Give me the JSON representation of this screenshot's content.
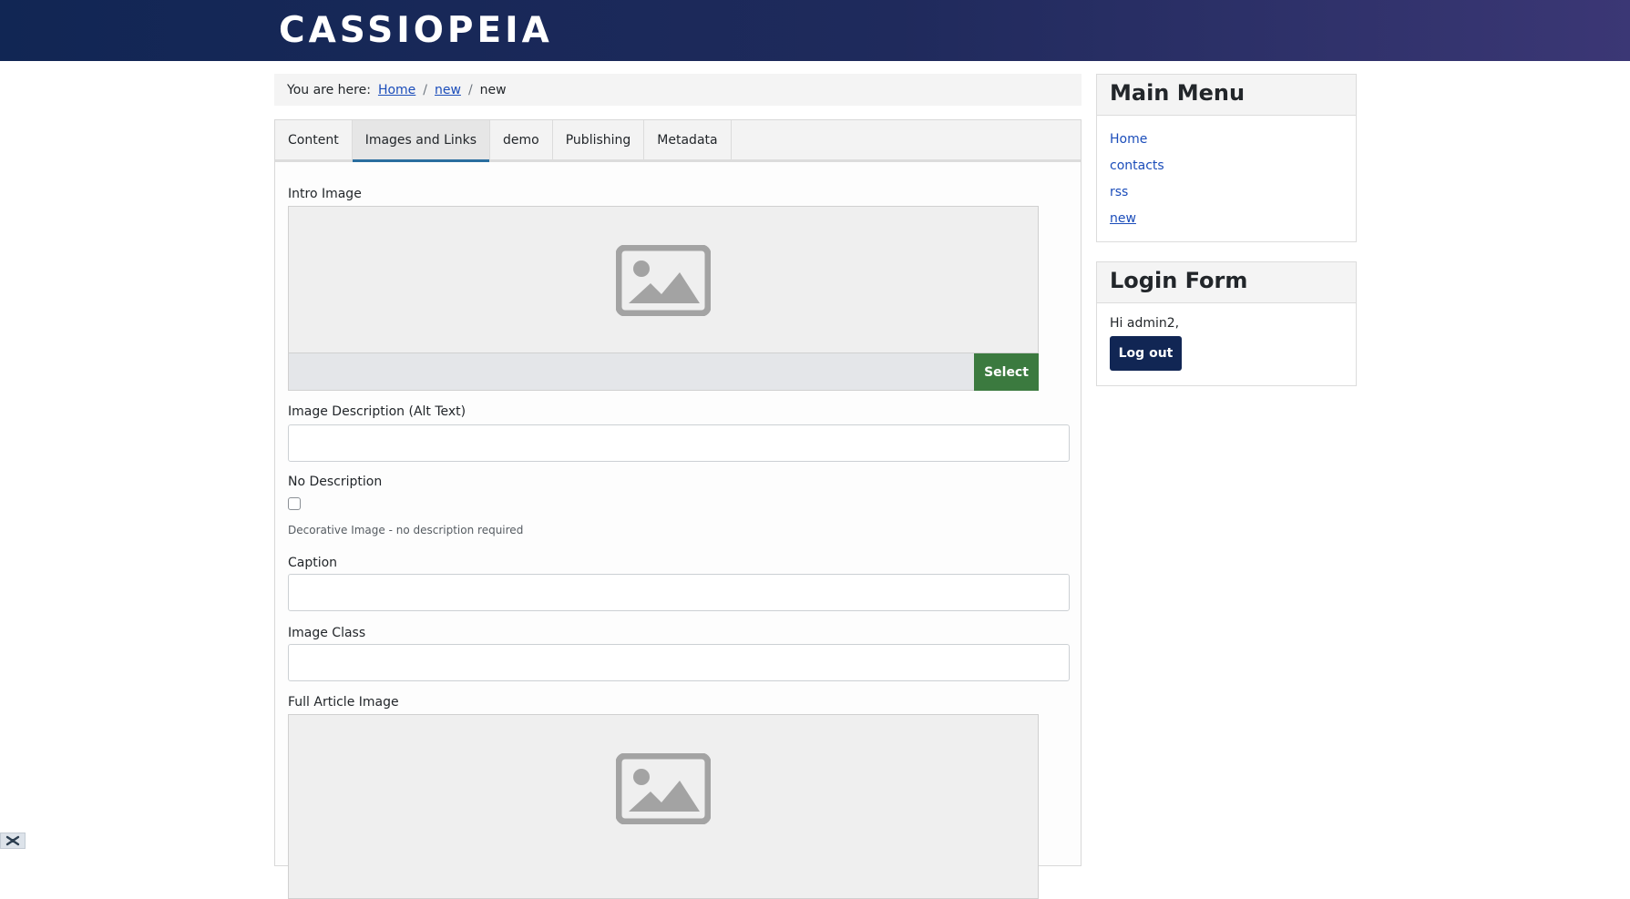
{
  "site": {
    "brand": "CASSIOPEIA"
  },
  "breadcrumb": {
    "prefix": "You are here:",
    "items": [
      "Home",
      "new",
      "new"
    ]
  },
  "tabs": [
    "Content",
    "Images and Links",
    "demo",
    "Publishing",
    "Metadata"
  ],
  "form": {
    "intro_image_label": "Intro Image",
    "select_label": "Select",
    "alt_text_label": "Image Description (Alt Text)",
    "no_description_label": "No Description",
    "decorative_hint": "Decorative Image - no description required",
    "caption_label": "Caption",
    "image_class_label": "Image Class",
    "full_article_image_label": "Full Article Image"
  },
  "main_menu": {
    "title": "Main Menu",
    "items": [
      "Home",
      "contacts",
      "rss",
      "new"
    ]
  },
  "login": {
    "title": "Login Form",
    "greeting": "Hi admin2,",
    "logout_label": "Log out"
  },
  "colors": {
    "header_start": "#112654",
    "header_end": "#3b3775",
    "select_button": "#3b7a3f",
    "logout_button": "#112654",
    "active_tab_accent": "#2a6e9f"
  }
}
